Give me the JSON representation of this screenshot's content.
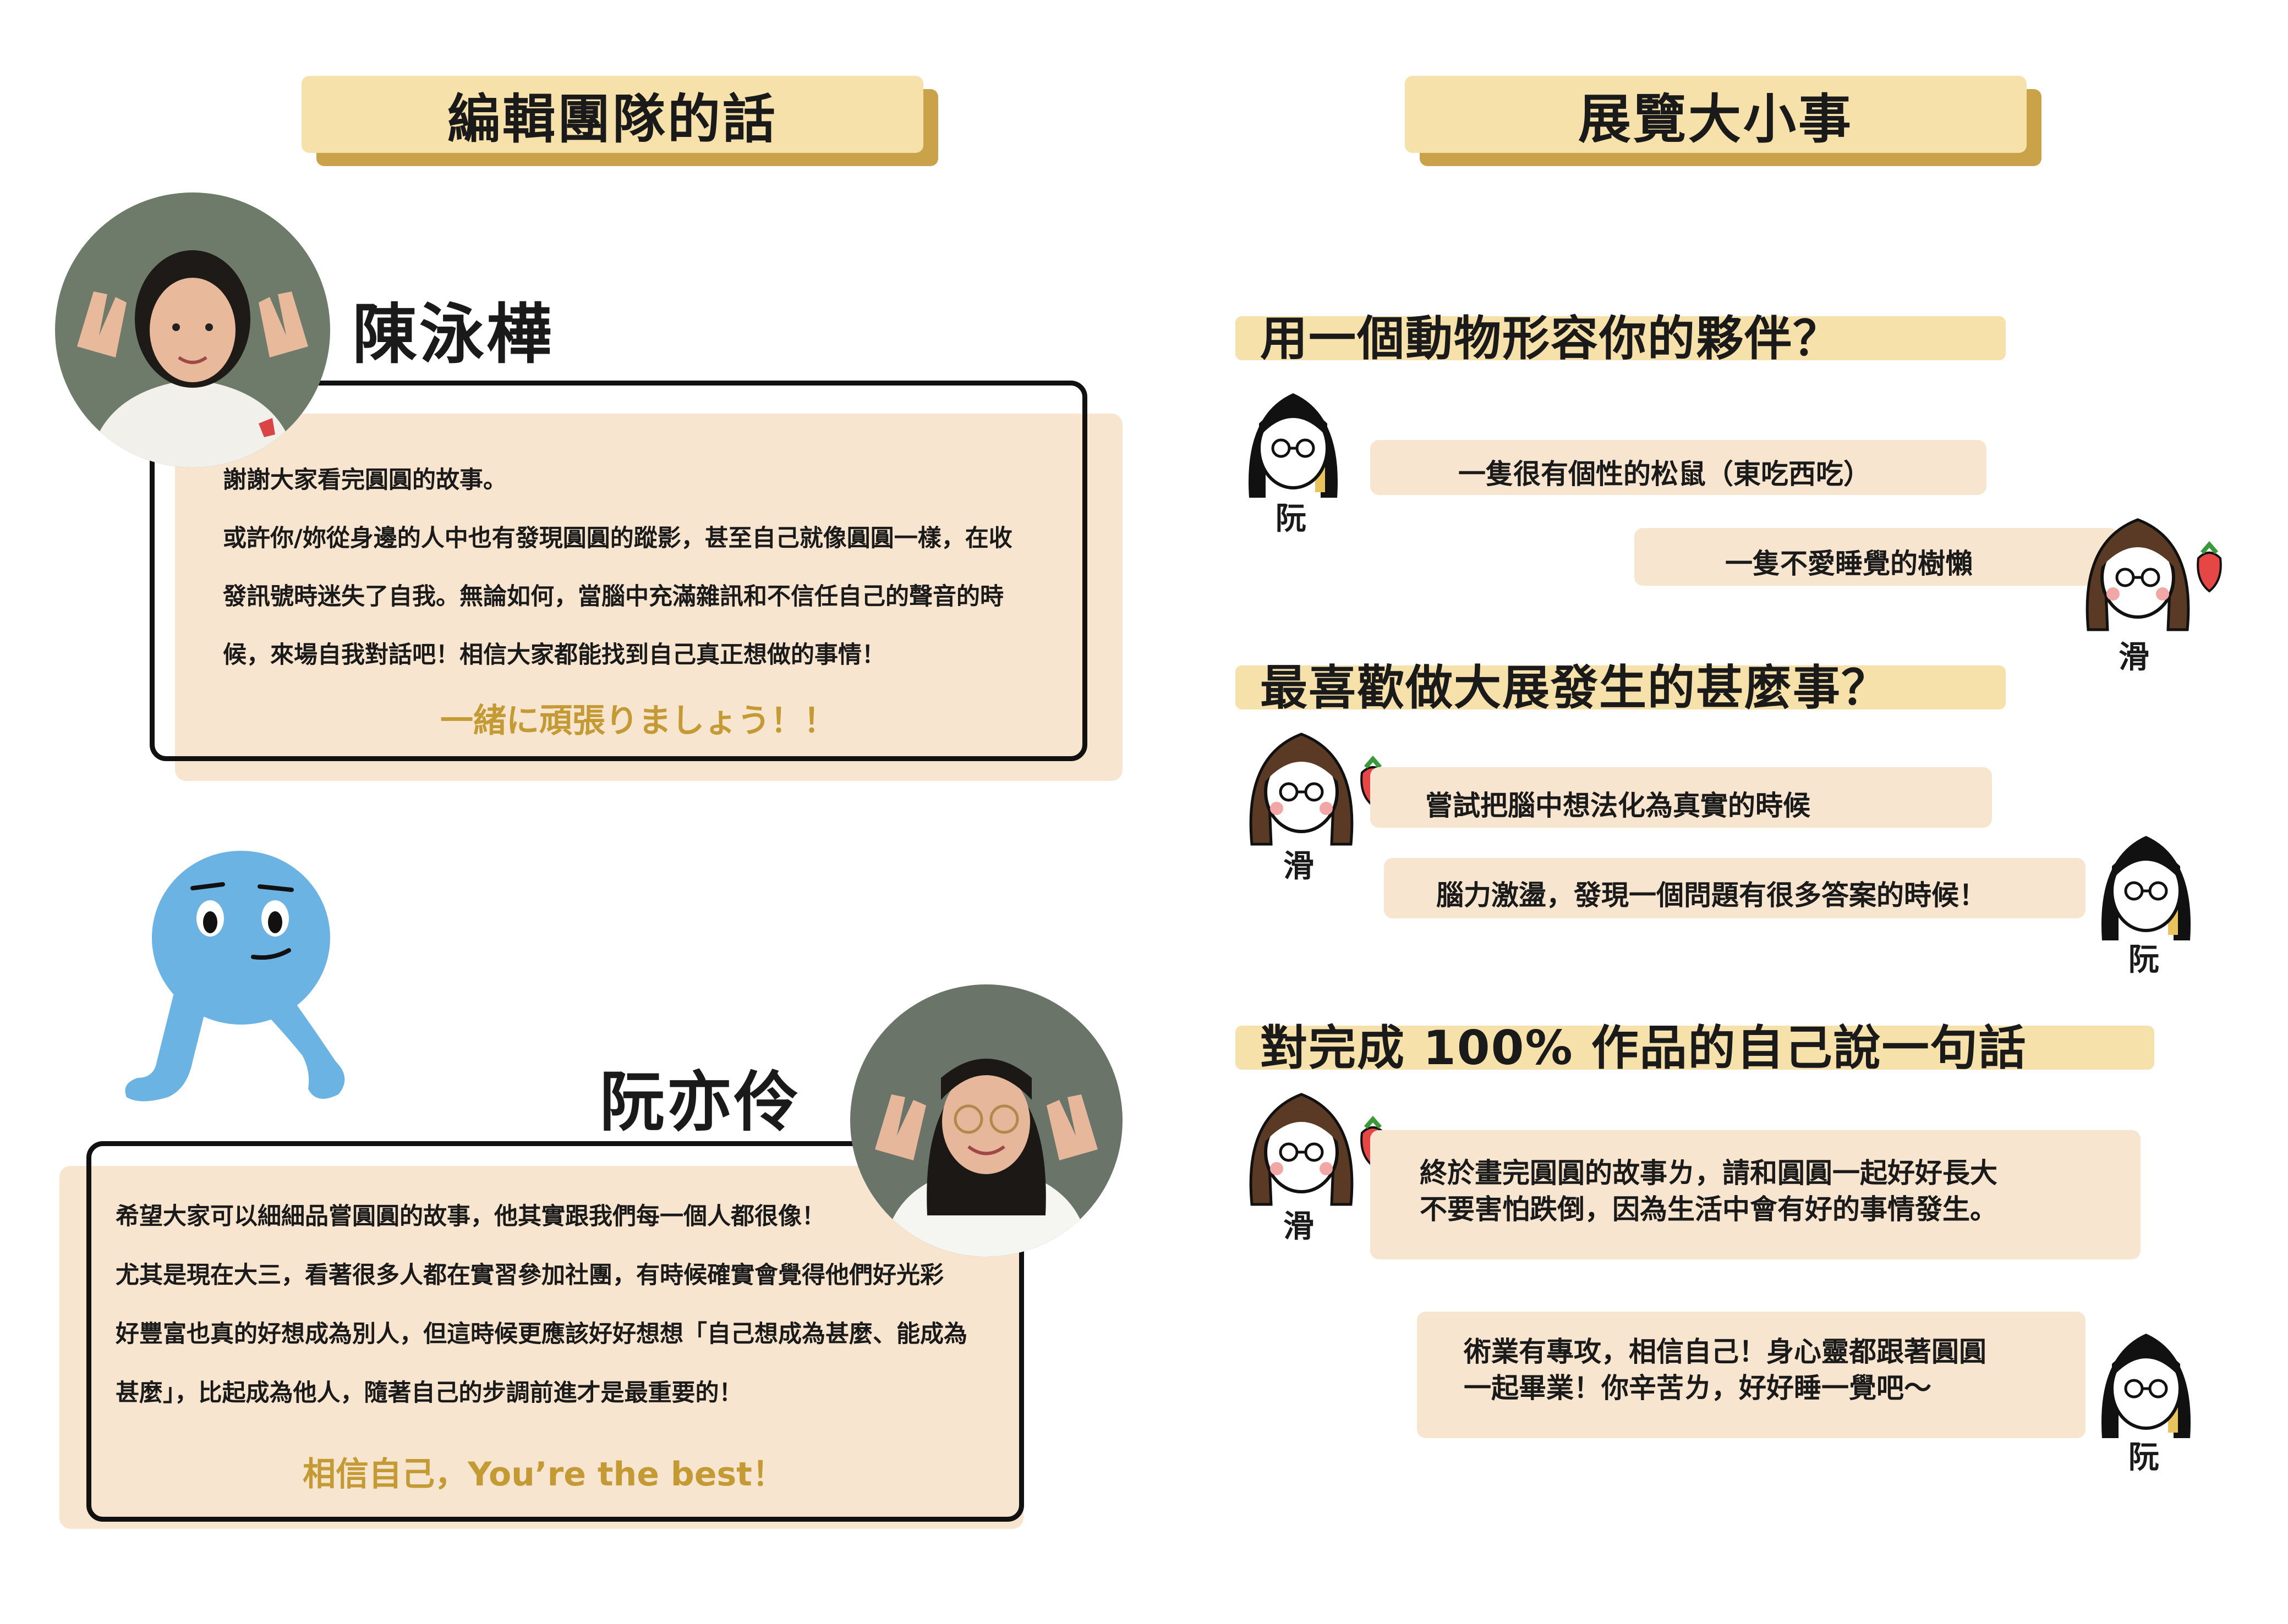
{
  "left_header": "編輯團隊的話",
  "right_header": "展覽大小事",
  "person1": {
    "name": "陳泳樺",
    "lines": [
      "謝謝大家看完圓圓的故事。",
      "或許你/妳從身邊的人中也有發現圓圓的蹤影，甚至自己就像圓圓一樣，在收",
      "發訊號時迷失了自我。無論如何，當腦中充滿雜訊和不信任自己的聲音的時",
      "候，來場自我對話吧！相信大家都能找到自己真正想做的事情！"
    ],
    "signoff": "一緒に頑張りましょう！！"
  },
  "person2": {
    "name": "阮亦伶",
    "lines": [
      "希望大家可以細細品嘗圓圓的故事，他其實跟我們每一個人都很像！",
      "尤其是現在大三，看著很多人都在實習參加社團，有時候確實會覺得他們好光彩",
      "好豐富也真的好想成為別人，但這時候更應該好好想想「自己想成為甚麼、能成為",
      "甚麼」，比起成為他人，隨著自己的步調前進才是最重要的！"
    ],
    "signoff": "相信自己，You’re the best！"
  },
  "q1": {
    "question": "用一個動物形容你的夥伴？",
    "a1": {
      "tag": "阮",
      "text": "一隻很有個性的松鼠（東吃西吃）"
    },
    "a2": {
      "tag": "滑",
      "text": "一隻不愛睡覺的樹懶"
    }
  },
  "q2": {
    "question": "最喜歡做大展發生的甚麼事？",
    "a1": {
      "tag": "滑",
      "text": "嘗試把腦中想法化為真實的時候"
    },
    "a2": {
      "tag": "阮",
      "text": "腦力激盪，發現一個問題有很多答案的時候！"
    }
  },
  "q3": {
    "question": "對完成 100% 作品的自己說一句話",
    "a1": {
      "tag": "滑",
      "lines": [
        "終於畫完圓圓的故事ㄌ，請和圓圓一起好好長大",
        "不要害怕跌倒，因為生活中會有好的事情發生。"
      ]
    },
    "a2": {
      "tag": "阮",
      "lines": [
        "術業有專攻，相信自己！身心靈都跟著圓圓",
        "一起畢業！你辛苦ㄌ，好好睡一覺吧～"
      ]
    }
  },
  "colors": {
    "plate": "#f6e1aa",
    "plate_shadow": "#c9a24a",
    "card": "#f8e5cf",
    "signoff": "#c49a35",
    "mascot": "#6bb3e3"
  }
}
